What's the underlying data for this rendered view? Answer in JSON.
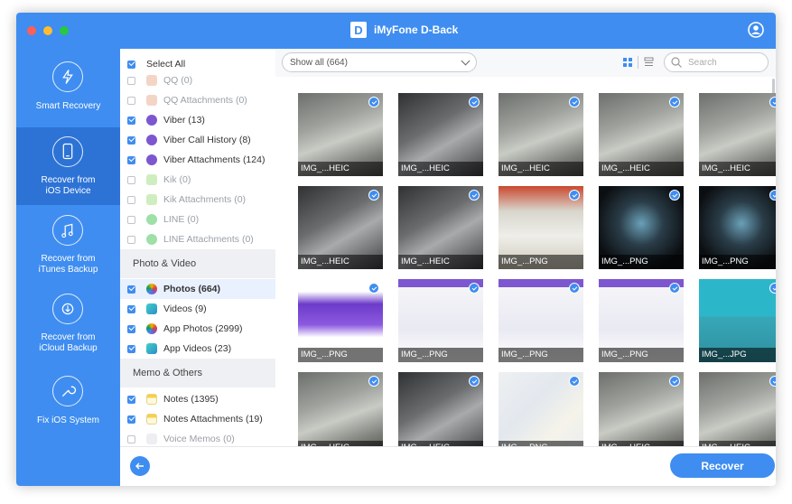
{
  "window": {
    "title": "iMyFone D-Back",
    "logo_letter": "D",
    "traffic_lights": [
      "#ff5f57",
      "#febc2e",
      "#28c840"
    ]
  },
  "colors": {
    "accent": "#3f8df0",
    "sidebar_active": "#2d73d6"
  },
  "sidebar": {
    "items": [
      {
        "label_line1": "Smart Recovery",
        "label_line2": "",
        "icon": "smart-recovery-icon",
        "active": false
      },
      {
        "label_line1": "Recover from",
        "label_line2": "iOS Device",
        "icon": "ios-device-icon",
        "active": true
      },
      {
        "label_line1": "Recover from",
        "label_line2": "iTunes Backup",
        "icon": "itunes-icon",
        "active": false
      },
      {
        "label_line1": "Recover from",
        "label_line2": "iCloud Backup",
        "icon": "icloud-icon",
        "active": false
      },
      {
        "label_line1": "Fix iOS System",
        "label_line2": "",
        "icon": "wrench-icon",
        "active": false
      }
    ]
  },
  "categories": {
    "select_all": "Select All",
    "rows": [
      {
        "label": "QQ (0)",
        "checked": false,
        "dim": true,
        "icon": "qq-icon"
      },
      {
        "label": "QQ Attachments (0)",
        "checked": false,
        "dim": true,
        "icon": "qq-icon"
      },
      {
        "label": "Viber (13)",
        "checked": true,
        "dim": false,
        "icon": "viber-icon"
      },
      {
        "label": "Viber Call History (8)",
        "checked": true,
        "dim": false,
        "icon": "viber-icon"
      },
      {
        "label": "Viber Attachments (124)",
        "checked": true,
        "dim": false,
        "icon": "viber-icon"
      },
      {
        "label": "Kik (0)",
        "checked": false,
        "dim": true,
        "icon": "kik-icon"
      },
      {
        "label": "Kik Attachments (0)",
        "checked": false,
        "dim": true,
        "icon": "kik-icon"
      },
      {
        "label": "LINE (0)",
        "checked": false,
        "dim": true,
        "icon": "line-icon"
      },
      {
        "label": "LINE Attachments (0)",
        "checked": false,
        "dim": true,
        "icon": "line-icon"
      }
    ],
    "section_photo": "Photo & Video",
    "photo_rows": [
      {
        "label": "Photos (664)",
        "checked": true,
        "selected": true,
        "icon": "photos-icon"
      },
      {
        "label": "Videos (9)",
        "checked": true,
        "selected": false,
        "icon": "videos-icon"
      },
      {
        "label": "App Photos (2999)",
        "checked": true,
        "selected": false,
        "icon": "photos-icon"
      },
      {
        "label": "App Videos (23)",
        "checked": true,
        "selected": false,
        "icon": "videos-icon"
      }
    ],
    "section_memo": "Memo & Others",
    "memo_rows": [
      {
        "label": "Notes (1395)",
        "checked": true,
        "dim": false,
        "icon": "notes-icon"
      },
      {
        "label": "Notes Attachments (19)",
        "checked": true,
        "dim": false,
        "icon": "notes-icon"
      },
      {
        "label": "Voice Memos (0)",
        "checked": false,
        "dim": true,
        "icon": "voice-memo-icon"
      }
    ]
  },
  "toolbar": {
    "filter_value": "Show all (664)",
    "search_placeholder": "Search"
  },
  "gallery": {
    "thumbs": [
      {
        "caption": "IMG_...HEIC",
        "kind": "car-silver"
      },
      {
        "caption": "IMG_...HEIC",
        "kind": "car-dark"
      },
      {
        "caption": "IMG_...HEIC",
        "kind": "car-silver"
      },
      {
        "caption": "IMG_...HEIC",
        "kind": "car-silver"
      },
      {
        "caption": "IMG_...HEIC",
        "kind": "car-silver"
      },
      {
        "caption": "IMG_...HEIC",
        "kind": "car-dark"
      },
      {
        "caption": "IMG_...HEIC",
        "kind": "car-dark"
      },
      {
        "caption": "IMG_...PNG",
        "kind": "note-red"
      },
      {
        "caption": "IMG_...PNG",
        "kind": "screen-dark"
      },
      {
        "caption": "IMG_...PNG",
        "kind": "screen-dark"
      },
      {
        "caption": "IMG_...PNG",
        "kind": "web-purple"
      },
      {
        "caption": "IMG_...PNG",
        "kind": "web-light"
      },
      {
        "caption": "IMG_...PNG",
        "kind": "web-light"
      },
      {
        "caption": "IMG_...PNG",
        "kind": "web-light"
      },
      {
        "caption": "IMG_...JPG",
        "kind": "comic"
      },
      {
        "caption": "IMG_...HEIC",
        "kind": "car-silver"
      },
      {
        "caption": "IMG_...HEIC",
        "kind": "car-dark"
      },
      {
        "caption": "IMG_...PNG",
        "kind": "map"
      },
      {
        "caption": "IMG_...HEIC",
        "kind": "car-silver"
      },
      {
        "caption": "IMG_...HEIC",
        "kind": "car-silver"
      }
    ]
  },
  "footer": {
    "recover_label": "Recover"
  }
}
